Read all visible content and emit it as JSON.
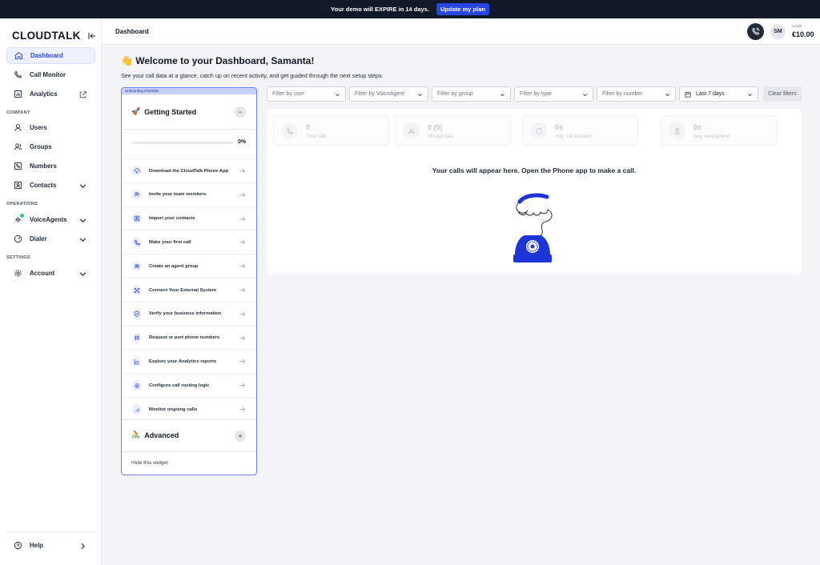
{
  "banner": {
    "text": "Your demo will EXPIRE in 14 days.",
    "button": "Update my plan"
  },
  "sidebar": {
    "logo": "CLOUDTALK",
    "items": [
      {
        "label": "Dashboard",
        "icon": "home-icon"
      },
      {
        "label": "Call Monitor",
        "icon": "phone-call-icon"
      },
      {
        "label": "Analytics",
        "icon": "analytics-icon"
      },
      {
        "label": "Users",
        "icon": "user-icon"
      },
      {
        "label": "Groups",
        "icon": "group-icon"
      },
      {
        "label": "Numbers",
        "icon": "numbers-icon"
      },
      {
        "label": "Contacts",
        "icon": "contacts-icon"
      },
      {
        "label": "VoiceAgents",
        "icon": "voiceagents-icon"
      },
      {
        "label": "Dialer",
        "icon": "dialer-icon"
      },
      {
        "label": "Account",
        "icon": "gear-icon"
      },
      {
        "label": "Help",
        "icon": "help-icon"
      }
    ],
    "sections": {
      "company": "COMPANY",
      "operations": "OPERATIONS",
      "settings": "SETTINGS"
    }
  },
  "header": {
    "title": "Dashboard",
    "avatar": "SM",
    "credit_label": "Credit",
    "credit_value": "€10.00"
  },
  "welcome": {
    "title": "👋 Welcome to your Dashboard, Samanta!",
    "subtitle": "See your call data at a glance, catch up on recent activity, and get guided through the next setup steps."
  },
  "widget": {
    "tag": "Onboarding Checklist",
    "getting_started": "Getting Started",
    "progress_label": "0%",
    "progress": 0,
    "tasks": [
      "Download the CloudTalk Phone App",
      "Invite your team members",
      "Import your contacts",
      "Make your first call",
      "Create an agent group",
      "Connect Your External System",
      "Verify your business information",
      "Request or port phone numbers",
      "Explore your Analytics reports",
      "Configure call routing logic",
      "Monitor ongoing calls"
    ],
    "advanced": "Advanced",
    "hide": "Hide this widget"
  },
  "filters": {
    "user": "Filter by user",
    "voiceagent": "Filter by VoiceAgent",
    "group": "Filter by group",
    "type": "Filter by type",
    "number": "Filter by number",
    "date": "Last 7 days",
    "clear": "Clear filters"
  },
  "stats": [
    {
      "value": "0",
      "label": "Total calls"
    },
    {
      "value": "0 (0)",
      "label": "Missed calls"
    },
    {
      "value": "0s",
      "label": "Avg. call duration"
    },
    {
      "value": "0s",
      "label": "Avg. waiting time"
    }
  ],
  "empty_message": "Your calls will appear here. Open the Phone app to make a call.",
  "colors": {
    "accent": "#2845e6",
    "banner_bg": "#111827",
    "illustration": "#1d35d6"
  }
}
